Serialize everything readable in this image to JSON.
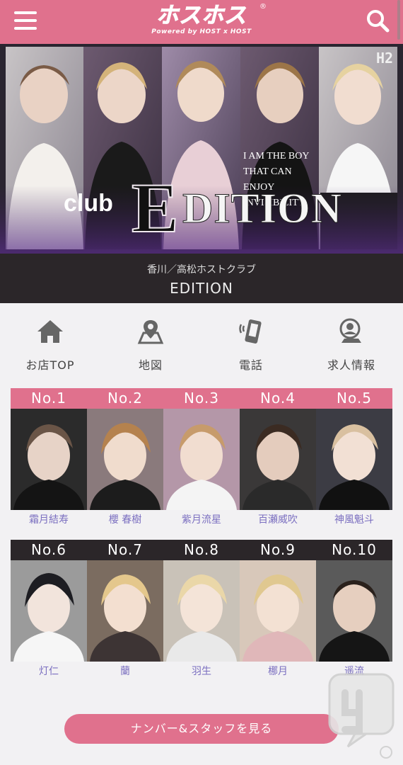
{
  "header": {
    "logo_main": "ホスホス",
    "logo_sub": "Powered by HOST x HOST",
    "logo_reg": "®"
  },
  "banner": {
    "club_word": "club",
    "e_letter": "E",
    "edition_word": "DITION",
    "h2_mark": "H2",
    "shirt_lines": [
      "I AM THE BOY",
      "THAT CAN",
      "ENJOY",
      "INVISIBILITY"
    ]
  },
  "club": {
    "subtitle": "香川／高松ホストクラブ",
    "name": "EDITION"
  },
  "nav": [
    {
      "label": "お店TOP",
      "icon": "home-icon"
    },
    {
      "label": "地図",
      "icon": "map-icon"
    },
    {
      "label": "電話",
      "icon": "phone-icon"
    },
    {
      "label": "求人情報",
      "icon": "recruit-icon"
    }
  ],
  "ranking_top": {
    "numbers": [
      "No.1",
      "No.2",
      "No.3",
      "No.4",
      "No.5"
    ],
    "names": [
      "霜月結寿",
      "櫻 春樹",
      "紫月流星",
      "百瀬威吹",
      "神風魁斗"
    ]
  },
  "ranking_bottom": {
    "numbers": [
      "No.6",
      "No.7",
      "No.8",
      "No.9",
      "No.10"
    ],
    "names": [
      "灯仁",
      "蘭",
      "羽生",
      "梛月",
      "遥流"
    ]
  },
  "cta": {
    "label": "ナンバー&スタッフを見る"
  },
  "colors": {
    "brand_pink": "#e0718d",
    "dark_header": "#2b2629",
    "name_purple": "#7b6fc0"
  }
}
